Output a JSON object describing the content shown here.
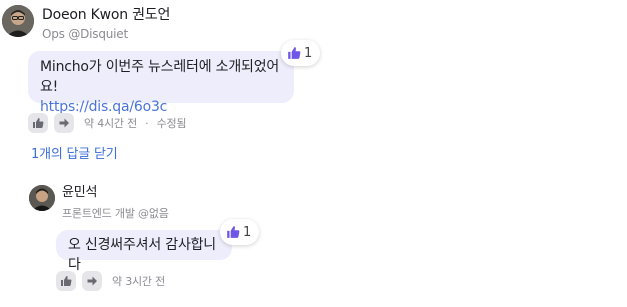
{
  "comment": {
    "author_name": "Doeon Kwon 권도언",
    "author_subtitle": "Ops @Disquiet",
    "text": "Mincho가 이번주 뉴스레터에 소개되었어요!",
    "link": "https://dis.qa/6o3c",
    "reaction_count": "1",
    "time": "약 4시간 전",
    "separator": "·",
    "edited": "수정됨"
  },
  "replies_toggle": "1개의 답글 닫기",
  "reply": {
    "author_name": "윤민석",
    "author_subtitle": "프론트엔드 개발 @없음",
    "text": "오 신경써주셔서 감사합니다",
    "reaction_count": "1",
    "time": "약 3시간 전"
  },
  "colors": {
    "bubble": "#eeedfb",
    "link": "#4a73d9",
    "reaction_icon": "#6e56e8",
    "meta_text": "#8b8b93"
  },
  "icons": {
    "reaction": "thumbs-up-icon",
    "upvote": "thumbs-up-icon",
    "downvote": "arrow-right-icon"
  }
}
